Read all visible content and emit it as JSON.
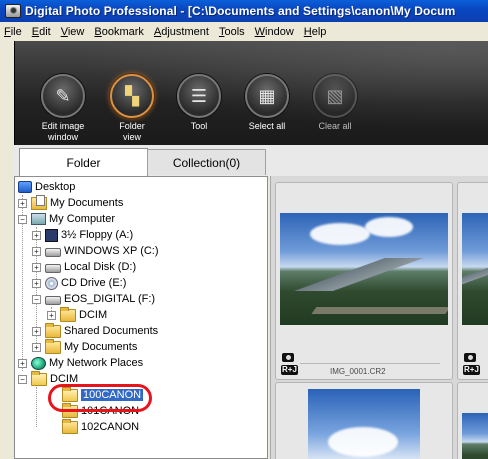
{
  "window": {
    "title": "Digital Photo Professional - [C:\\Documents and Settings\\canon\\My Docum"
  },
  "menubar": {
    "items": [
      {
        "label": "File",
        "mnemonic": "F",
        "rest": "ile"
      },
      {
        "label": "Edit",
        "mnemonic": "E",
        "rest": "dit"
      },
      {
        "label": "View",
        "mnemonic": "V",
        "rest": "iew"
      },
      {
        "label": "Bookmark",
        "mnemonic": "B",
        "rest": "ookmark"
      },
      {
        "label": "Adjustment",
        "mnemonic": "A",
        "rest": "djustment"
      },
      {
        "label": "Tools",
        "mnemonic": "T",
        "rest": "ools"
      },
      {
        "label": "Window",
        "mnemonic": "W",
        "rest": "indow"
      },
      {
        "label": "Help",
        "mnemonic": "H",
        "rest": "elp"
      }
    ]
  },
  "toolbar": {
    "buttons": [
      {
        "label_line1": "Edit image",
        "label_line2": "window",
        "icon": "edit-image-icon",
        "glyph": "✎"
      },
      {
        "label_line1": "Folder",
        "label_line2": "view",
        "icon": "folder-view-icon",
        "glyph": "▚",
        "active": true
      },
      {
        "label_line1": "Tool",
        "label_line2": "",
        "icon": "tool-icon",
        "glyph": "☰"
      },
      {
        "label_line1": "Select all",
        "label_line2": "",
        "icon": "select-all-icon",
        "glyph": "▦"
      },
      {
        "label_line1": "Clear all",
        "label_line2": "",
        "icon": "clear-all-icon",
        "glyph": "▧",
        "dim": true
      }
    ]
  },
  "tabs": {
    "folder": "Folder",
    "collection": "Collection(0)"
  },
  "tree": {
    "desktop": "Desktop",
    "my_documents": "My Documents",
    "my_computer": "My Computer",
    "floppy": "3½ Floppy (A:)",
    "windows_xp": "WINDOWS XP (C:)",
    "local_disk": "Local Disk (D:)",
    "cd_drive": "CD Drive (E:)",
    "eos_digital": "EOS_DIGITAL (F:)",
    "dcim_f": "DCIM",
    "shared_documents": "Shared Documents",
    "my_documents_sub": "My Documents",
    "network_places": "My Network Places",
    "dcim": "DCIM",
    "canon100": "100CANON",
    "canon101": "101CANON",
    "canon102": "102CANON"
  },
  "thumbnails": {
    "first_file": "IMG_0001.CR2",
    "badge": "R+J"
  },
  "colors": {
    "titlebar": "#0a47c2",
    "selection": "#316ac5",
    "highlight_ring": "#e8141b"
  }
}
